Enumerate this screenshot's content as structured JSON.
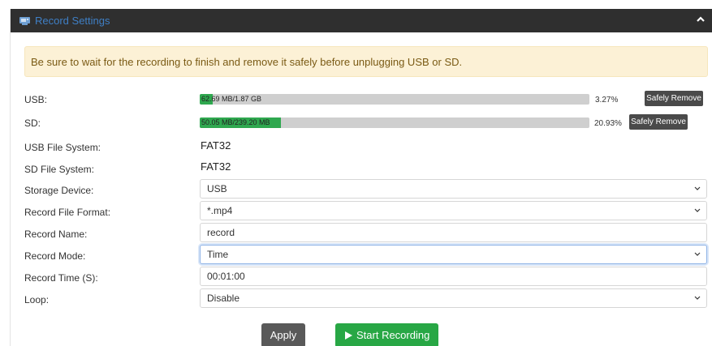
{
  "panel": {
    "title": "Record Settings",
    "header_icon": "record-settings-icon",
    "collapse_icon": "chevron-up-icon"
  },
  "alert": {
    "text": "Be sure to wait for the recording to finish and remove it safely before unplugging USB or SD."
  },
  "usb": {
    "label": "USB:",
    "usage_text": "62.69 MB/1.87 GB",
    "percent_text": "3.27%",
    "fill_fraction": 0.0327,
    "button": "Safely Remove"
  },
  "sd": {
    "label": "SD:",
    "usage_text": "50.05 MB/239.20 MB",
    "percent_text": "20.93%",
    "fill_fraction": 0.2093,
    "button": "Safely Remove"
  },
  "usb_fs": {
    "label": "USB File System:",
    "value": "FAT32"
  },
  "sd_fs": {
    "label": "SD File System:",
    "value": "FAT32"
  },
  "storage_device": {
    "label": "Storage Device:",
    "value": "USB"
  },
  "file_format": {
    "label": "Record File Format:",
    "value": "*.mp4"
  },
  "record_name": {
    "label": "Record Name:",
    "value": "record"
  },
  "record_mode": {
    "label": "Record Mode:",
    "value": "Time"
  },
  "record_time": {
    "label": "Record Time (S):",
    "value": "00:01:00"
  },
  "loop": {
    "label": "Loop:",
    "value": "Disable"
  },
  "actions": {
    "apply": "Apply",
    "start": "Start Recording",
    "start_icon": "play-icon"
  },
  "colors": {
    "header_bg": "#2f2f2f",
    "title": "#3f7fc5",
    "alert_bg": "#fcf1d6",
    "progress_fill": "#2fa84f",
    "start_button": "#28a745",
    "apply_button": "#595959"
  }
}
